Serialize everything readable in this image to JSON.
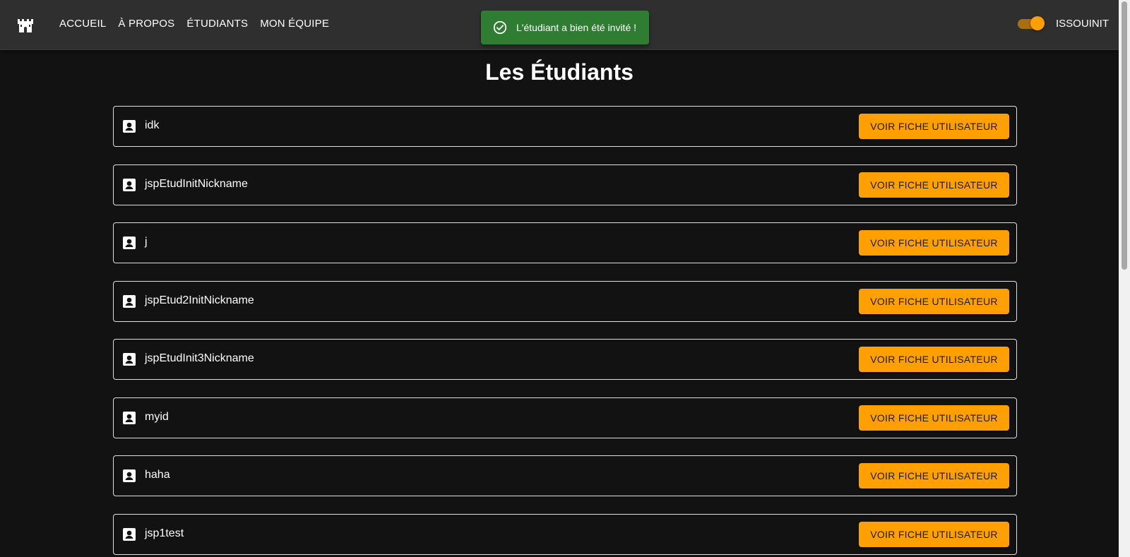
{
  "nav": {
    "items": [
      "ACCUEIL",
      "À PROPOS",
      "ÉTUDIANTS",
      "MON ÉQUIPE"
    ]
  },
  "toast": {
    "message": "L'étudiant a bien été invité !",
    "icon": "check-circle-icon",
    "color": "#2e7d32"
  },
  "header": {
    "username": "ISSOUINIT",
    "theme_toggle_on": true,
    "accent": "#ffa000"
  },
  "main": {
    "title": "Les Étudiants",
    "students": [
      {
        "name": "idk"
      },
      {
        "name": "jspEtudInitNickname"
      },
      {
        "name": "j"
      },
      {
        "name": "jspEtud2InitNickname"
      },
      {
        "name": "jspEtudInit3Nickname"
      },
      {
        "name": "myid"
      },
      {
        "name": "haha"
      },
      {
        "name": "jsp1test"
      }
    ],
    "button_label": "VOIR FICHE UTILISATEUR"
  }
}
